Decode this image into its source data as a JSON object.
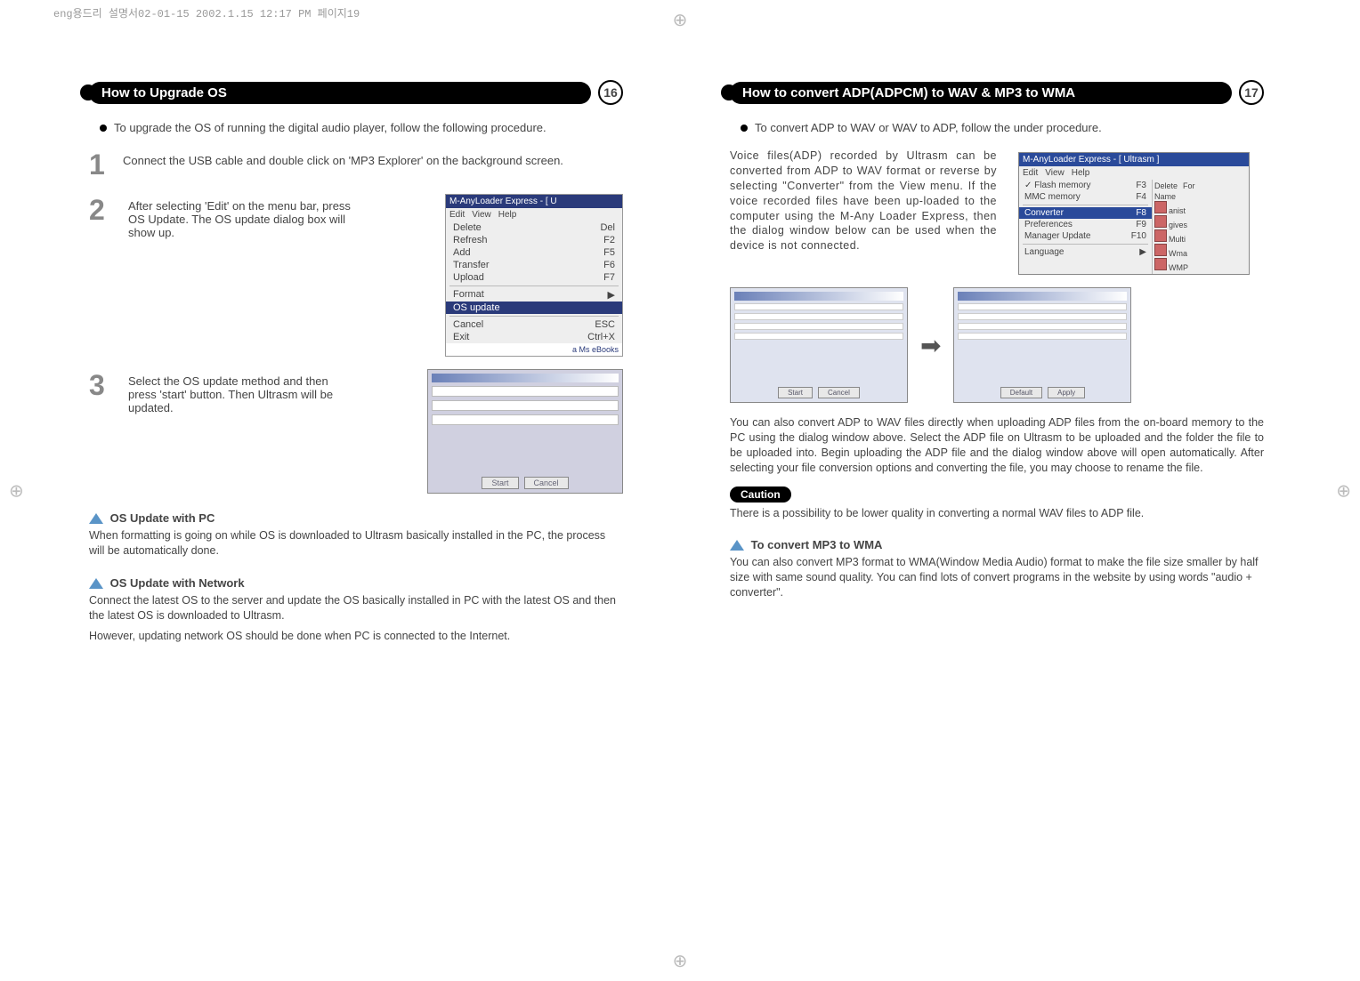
{
  "slug": "eng용드리 설명서02-01-15  2002.1.15 12:17 PM  페이지19",
  "left": {
    "title": "How to Upgrade OS",
    "pagenum": "16",
    "lead": "To upgrade the OS of running the digital audio player, follow the following procedure.",
    "step1": "Connect the USB cable and double click on 'MP3 Explorer' on the background screen.",
    "step2": "After selecting 'Edit' on the menu bar, press   OS Update. The OS update dialog box will show up.",
    "step3": "Select the OS update method and then press 'start' button. Then Ultrasm will be updated.",
    "dropdown": {
      "titlebar": "M-AnyLoader Express - [ U",
      "menubar": [
        "Edit",
        "View",
        "Help"
      ],
      "items": [
        {
          "label": "Delete",
          "accel": "Del"
        },
        {
          "label": "Refresh",
          "accel": "F2"
        },
        {
          "label": "Add",
          "accel": "F5"
        },
        {
          "label": "Transfer",
          "accel": "F6"
        },
        {
          "label": "Upload",
          "accel": "F7"
        }
      ],
      "group2": [
        {
          "label": "Format",
          "accel": "▶"
        },
        {
          "label": "OS update",
          "accel": ""
        }
      ],
      "group3": [
        {
          "label": "Cancel",
          "accel": "ESC"
        },
        {
          "label": "Exit",
          "accel": "Ctrl+X"
        }
      ],
      "footer": "a Ms eBooks"
    },
    "dialog": {
      "buttons": [
        "Start",
        "Cancel"
      ]
    },
    "sub1_title": "OS Update with PC",
    "sub1_body": "When formatting is going on while OS is downloaded to Ultrasm basically installed in the PC, the process will be automatically done.",
    "sub2_title": "OS Update with Network",
    "sub2_body1": "Connect the latest OS to the server and update the OS basically installed in PC with the latest OS and then the latest OS is downloaded to Ultrasm.",
    "sub2_body2": "However, updating network OS should be done when PC is connected to the Internet."
  },
  "right": {
    "title": "How to convert ADP(ADPCM) to WAV & MP3 to WMA",
    "pagenum": "17",
    "lead": "To convert ADP to WAV or WAV to ADP, follow the under procedure.",
    "para1": "Voice files(ADP) recorded by Ultrasm can be converted from ADP to WAV format or reverse by selecting \"Converter\" from the View menu. If the voice recorded files have been up-loaded to the computer using the M-Any Loader Express, then the dialog window below can be used when the device is not connected.",
    "menu": {
      "titlebar": "M-AnyLoader Express - [ Ultrasm ]",
      "menubar": [
        "Edit",
        "View",
        "Help"
      ],
      "leftItems": [
        {
          "label": "✓ Flash memory",
          "accel": "F3"
        },
        {
          "label": "  MMC memory",
          "accel": "F4"
        }
      ],
      "leftItems2": [
        {
          "label": "Converter",
          "accel": "F8",
          "hl": true
        },
        {
          "label": "Preferences",
          "accel": "F9"
        },
        {
          "label": "Manager Update",
          "accel": "F10"
        }
      ],
      "leftItems3": [
        {
          "label": "Language",
          "accel": "▶"
        }
      ],
      "rightHeaders": [
        "Delete",
        "For"
      ],
      "rightRows": [
        "Name",
        "anist",
        "gives",
        "Multi",
        "Wma",
        "WMP"
      ]
    },
    "screens": {
      "buttons_left": [
        "Start",
        "Cancel"
      ],
      "buttons_right": [
        "Default",
        "Apply"
      ]
    },
    "para2": "You can also convert ADP to WAV files directly when uploading ADP files from the on-board memory to the PC using the dialog window above. Select the ADP file on Ultrasm to be uploaded and the folder the file to be uploaded into. Begin uploading the ADP file and the dialog window above will open automatically. After selecting your file conversion options and converting the file, you may choose to rename the file.",
    "caution_label": "Caution",
    "caution_body": "There is a possibility to be lower quality in converting a normal WAV files to ADP file.",
    "sub_title": "To convert MP3 to WMA",
    "sub_body": "You can also convert MP3 format to WMA(Window Media Audio) format to make the file size smaller by half size with same sound quality. You can find lots of convert programs in the website by using words \"audio + converter\"."
  }
}
